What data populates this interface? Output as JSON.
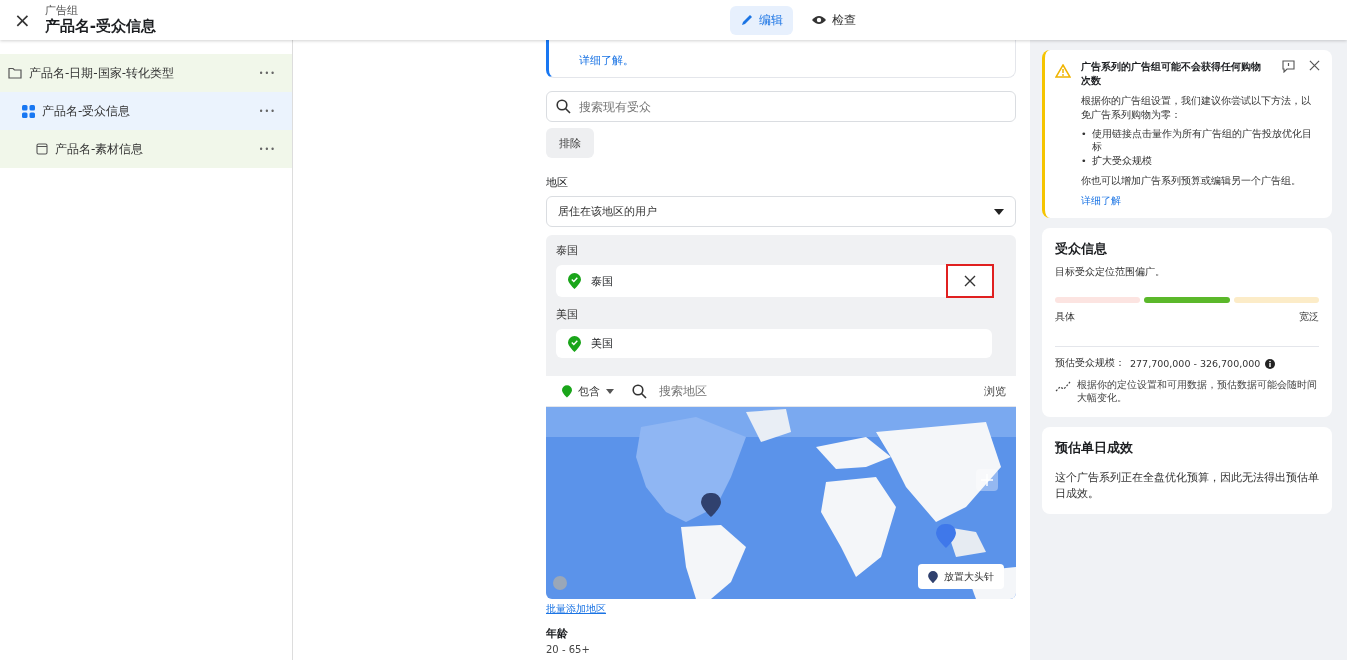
{
  "header": {
    "close": "×",
    "subtitle": "广告组",
    "title": "产品名-受众信息"
  },
  "tabs": [
    {
      "label": "编辑",
      "kind": "edit",
      "selected": true
    },
    {
      "label": "检查",
      "kind": "view",
      "selected": false
    }
  ],
  "tree": [
    {
      "label": "产品名-日期-国家-转化类型",
      "kind": "campaign",
      "selected": false,
      "more": "•••",
      "children": [
        {
          "label": "产品名-受众信息",
          "kind": "adset",
          "selected": true,
          "more": "•••",
          "children": [
            {
              "label": "产品名-素材信息",
              "kind": "ad",
              "selected": false,
              "more": "•••"
            }
          ]
        }
      ]
    }
  ],
  "notice": {
    "link": "详细了解。"
  },
  "audience_search": {
    "placeholder": "搜索现有受众"
  },
  "exclude_button": "排除",
  "region": {
    "label": "地区",
    "dropdown": "居住在该地区的用户",
    "groups": [
      {
        "heading": "泰国",
        "location": "泰国",
        "highlighted": true
      },
      {
        "heading": "美国",
        "location": "美国",
        "highlighted": false
      }
    ],
    "include": "包含",
    "search_placeholder": "搜索地区",
    "browse": "浏览",
    "map": {
      "kind": "picture",
      "pin_button": "放置大头针"
    },
    "bulk_link": "批量添加地区"
  },
  "age": {
    "label": "年龄",
    "value": "20 - 65+"
  },
  "warning": {
    "title": "广告系列的广告组可能不会获得任何购物次数",
    "body": "根据你的广告组设置，我们建议你尝试以下方法，以免广告系列购物为零：",
    "bullets": [
      {
        "marker": "•",
        "text": "使用链接点击量作为所有广告组的广告投放优化目标"
      },
      {
        "marker": "•",
        "text": "扩大受众规模"
      }
    ],
    "footer": "你也可以增加广告系列预算或编辑另一个广告组。",
    "link": "详细了解"
  },
  "audience": {
    "title": "受众信息",
    "summary": "目标受众定位范围偏广。",
    "segments": [
      {
        "color": "#fce4e1"
      },
      {
        "color": "#5bb82a"
      },
      {
        "color": "#fcecc8"
      }
    ],
    "left": "具体",
    "right": "宽泛",
    "size_label": "预估受众规模：",
    "size": "277,700,000 - 326,700,000",
    "note": "根据你的定位设置和可用数据，预估数据可能会随时间大幅变化。"
  },
  "daily": {
    "title": "预估单日成效",
    "text": "这个广告系列正在全盘优化预算，因此无法得出预估单日成效。"
  }
}
